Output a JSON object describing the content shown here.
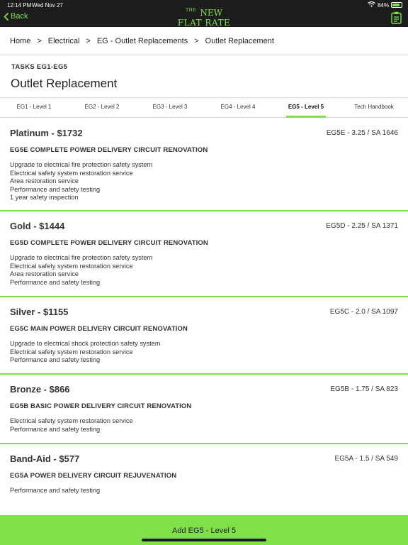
{
  "status": {
    "time": "12:14 PM",
    "date": "Wed Nov 27",
    "battery": "84%",
    "battery_level": 0.84
  },
  "nav": {
    "back_label": "Back",
    "logo_the": "THE",
    "logo_new": "NEW",
    "logo_line2": "FLAT RATE"
  },
  "breadcrumb": [
    "Home",
    "Electrical",
    "EG - Outlet Replacements",
    "Outlet Replacement"
  ],
  "breadcrumb_separator": ">",
  "header": {
    "tasks_label": "TASKS EG1-EG5",
    "title": "Outlet Replacement"
  },
  "tabs": [
    "EG1 - Level 1",
    "EG2 - Level 2",
    "EG3 - Level 3",
    "EG4 - Level 4",
    "EG5 - Level 5",
    "Tech Handbook"
  ],
  "active_tab": 4,
  "cards": [
    {
      "title": "Platinum - $1732",
      "code": "EG5E - 3.25 / SA 1646",
      "subtitle": "EG5E COMPLETE POWER DELIVERY CIRCUIT RENOVATION",
      "items": [
        "Upgrade to electrical fire protection safety system",
        "Electrical safety system restoration service",
        "Area restoration service",
        "Performance and safety testing",
        "1 year safety inspection"
      ]
    },
    {
      "title": "Gold - $1444",
      "code": "EG5D - 2.25 / SA 1371",
      "subtitle": "EG5D COMPLETE POWER DELIVERY CIRCUIT RENOVATION",
      "items": [
        "Upgrade to electrical fire protection safety system",
        "Electrical safety system restoration service",
        "Area restoration service",
        "Performance and safety testing"
      ]
    },
    {
      "title": "Silver - $1155",
      "code": "EG5C - 2.0 / SA 1097",
      "subtitle": "EG5C MAIN POWER DELIVERY CIRCUIT RENOVATION",
      "items": [
        "Upgrade to electrical shock protection safety system",
        "Electrical safety system restoration service",
        "Performance and safety testing"
      ]
    },
    {
      "title": "Bronze - $866",
      "code": "EG5B - 1.75 / SA 823",
      "subtitle": "EG5B BASIC POWER DELIVERY CIRCUIT RENOVATION",
      "items": [
        "Electrical safety system restoration service",
        "Performance and safety testing"
      ]
    },
    {
      "title": "Band-Aid - $577",
      "code": "EG5A - 1.5 / SA 549",
      "subtitle": "EG5A POWER DELIVERY CIRCUIT REJUVENATION",
      "items": [
        "Performance and safety testing"
      ]
    }
  ],
  "bottom_button": "Add EG5 - Level 5",
  "colors": {
    "accent": "#7fe04a",
    "bar": "#1c1c1c",
    "text": "#333333"
  },
  "icons": [
    "back-chevron-icon",
    "wifi-icon",
    "battery-icon",
    "clipboard-icon"
  ]
}
